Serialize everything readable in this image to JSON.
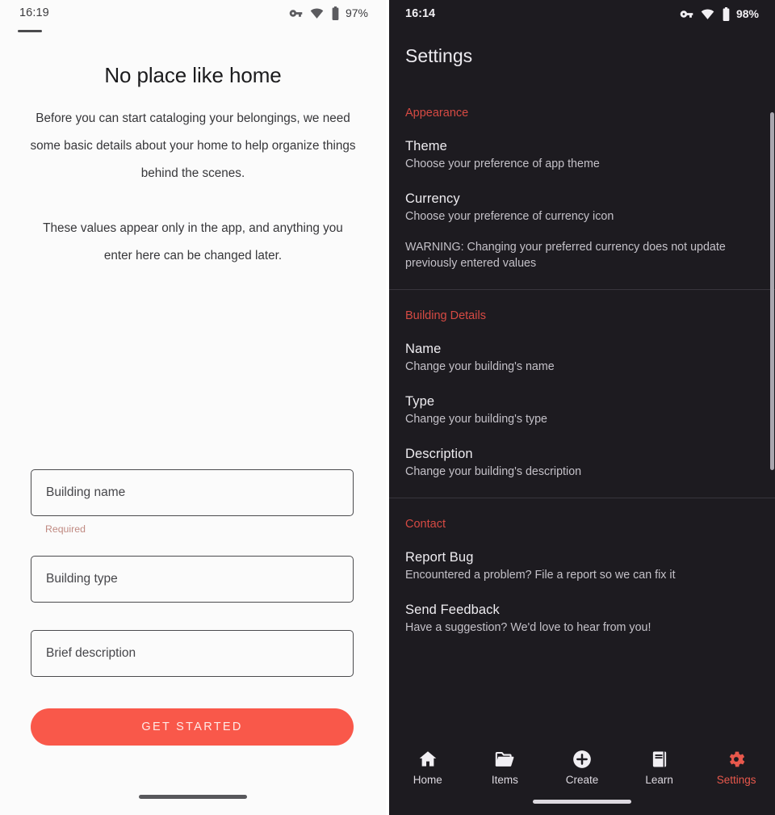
{
  "left_panel": {
    "status_bar": {
      "time": "16:19",
      "battery_percent": "97%",
      "icons": [
        "vpn-key-icon",
        "wifi-icon",
        "battery-icon"
      ]
    },
    "title": "No place like home",
    "paragraph_1": "Before you can start cataloging your belongings, we need some basic details about your home to help organize things behind the scenes.",
    "paragraph_2": "These values appear only in the app, and anything you enter here can be changed later.",
    "fields": [
      {
        "name": "building-name",
        "placeholder": "Building name",
        "value": "",
        "helper": "Required"
      },
      {
        "name": "building-type",
        "placeholder": "Building type",
        "value": ""
      },
      {
        "name": "brief-description",
        "placeholder": "Brief description",
        "value": ""
      }
    ],
    "primary_button": "GET STARTED",
    "accent_color": "#f9584a",
    "helper_color": "#c08a82"
  },
  "right_panel": {
    "status_bar": {
      "time": "16:14",
      "battery_percent": "98%",
      "icons": [
        "vpn-key-icon",
        "wifi-icon",
        "battery-icon"
      ]
    },
    "title": "Settings",
    "accent_color": "#d64a43",
    "background_color": "#1d1b20",
    "sections": [
      {
        "header": "Appearance",
        "items": [
          {
            "title": "Theme",
            "subtitle": "Choose your preference of app theme"
          },
          {
            "title": "Currency",
            "subtitle": "Choose your preference of currency icon"
          }
        ],
        "note": "WARNING: Changing your preferred currency does not update previously entered values"
      },
      {
        "header": "Building Details",
        "items": [
          {
            "title": "Name",
            "subtitle": "Change your building's name"
          },
          {
            "title": "Type",
            "subtitle": "Change your building's type"
          },
          {
            "title": "Description",
            "subtitle": "Change your building's description"
          }
        ]
      },
      {
        "header": "Contact",
        "items": [
          {
            "title": "Report Bug",
            "subtitle": "Encountered a problem? File a report so we can fix it"
          },
          {
            "title": "Send Feedback",
            "subtitle": "Have a suggestion? We'd love to hear from you!"
          }
        ]
      }
    ],
    "bottom_nav": [
      {
        "label": "Home",
        "icon": "home-icon",
        "active": false
      },
      {
        "label": "Items",
        "icon": "folder-icon",
        "active": false
      },
      {
        "label": "Create",
        "icon": "plus-circle-icon",
        "active": false
      },
      {
        "label": "Learn",
        "icon": "book-icon",
        "active": false
      },
      {
        "label": "Settings",
        "icon": "gear-icon",
        "active": true
      }
    ]
  }
}
